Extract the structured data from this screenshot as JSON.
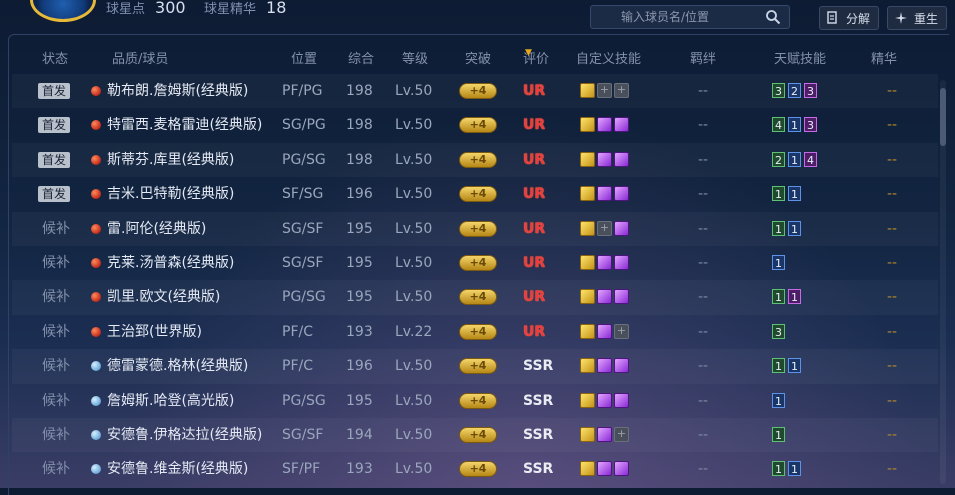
{
  "topbar": {
    "points_label": "球星点",
    "points_value": "300",
    "essence_label": "球星精华",
    "essence_value": "18",
    "search_placeholder": "输入球员名/位置",
    "decompose_label": "分解",
    "rebirth_label": "重生"
  },
  "table": {
    "headers": [
      "状态",
      "品质/球员",
      "位置",
      "综合",
      "等级",
      "突破",
      "评价",
      "自定义技能",
      "羁绊",
      "天赋技能",
      "精华"
    ],
    "sort_column": "评价",
    "rows": [
      {
        "status": "首发",
        "starter": true,
        "quality": "red",
        "name": "勒布朗.詹姆斯(经典版)",
        "position": "PF/PG",
        "overall": "198",
        "level": "Lv.50",
        "breakthrough": "+4",
        "rating": "UR",
        "skills": [
          "crown",
          "empty",
          "empty"
        ],
        "bond": "--",
        "talents": [
          {
            "v": "3",
            "c": "green"
          },
          {
            "v": "2",
            "c": "blue"
          },
          {
            "v": "3",
            "c": "purple"
          }
        ],
        "essence": "--"
      },
      {
        "status": "首发",
        "starter": true,
        "quality": "red",
        "name": "特雷西.麦格雷迪(经典版)",
        "position": "SG/PG",
        "overall": "198",
        "level": "Lv.50",
        "breakthrough": "+4",
        "rating": "UR",
        "skills": [
          "crown",
          "purple",
          "purple"
        ],
        "bond": "--",
        "talents": [
          {
            "v": "4",
            "c": "green"
          },
          {
            "v": "1",
            "c": "blue"
          },
          {
            "v": "3",
            "c": "purple"
          }
        ],
        "essence": "--"
      },
      {
        "status": "首发",
        "starter": true,
        "quality": "red",
        "name": "斯蒂芬.库里(经典版)",
        "position": "PG/SG",
        "overall": "198",
        "level": "Lv.50",
        "breakthrough": "+4",
        "rating": "UR",
        "skills": [
          "crown",
          "purple",
          "purple"
        ],
        "bond": "--",
        "talents": [
          {
            "v": "2",
            "c": "green"
          },
          {
            "v": "1",
            "c": "blue"
          },
          {
            "v": "4",
            "c": "purple"
          }
        ],
        "essence": "--"
      },
      {
        "status": "首发",
        "starter": true,
        "quality": "red",
        "name": "吉米.巴特勒(经典版)",
        "position": "SF/SG",
        "overall": "196",
        "level": "Lv.50",
        "breakthrough": "+4",
        "rating": "UR",
        "skills": [
          "crown",
          "purple",
          "purple"
        ],
        "bond": "--",
        "talents": [
          {
            "v": "1",
            "c": "green"
          },
          {
            "v": "1",
            "c": "blue"
          }
        ],
        "essence": "--"
      },
      {
        "status": "候补",
        "starter": false,
        "quality": "red",
        "name": "雷.阿伦(经典版)",
        "position": "SG/SF",
        "overall": "195",
        "level": "Lv.50",
        "breakthrough": "+4",
        "rating": "UR",
        "skills": [
          "crown",
          "empty",
          "purple"
        ],
        "bond": "--",
        "talents": [
          {
            "v": "1",
            "c": "green"
          },
          {
            "v": "1",
            "c": "blue"
          }
        ],
        "essence": "--"
      },
      {
        "status": "候补",
        "starter": false,
        "quality": "red",
        "name": "克莱.汤普森(经典版)",
        "position": "SG/SF",
        "overall": "195",
        "level": "Lv.50",
        "breakthrough": "+4",
        "rating": "UR",
        "skills": [
          "crown",
          "purple",
          "purple"
        ],
        "bond": "--",
        "talents": [
          {
            "v": "1",
            "c": "blue"
          }
        ],
        "essence": "--"
      },
      {
        "status": "候补",
        "starter": false,
        "quality": "red",
        "name": "凯里.欧文(经典版)",
        "position": "PG/SG",
        "overall": "195",
        "level": "Lv.50",
        "breakthrough": "+4",
        "rating": "UR",
        "skills": [
          "crown",
          "purple",
          "purple"
        ],
        "bond": "--",
        "talents": [
          {
            "v": "1",
            "c": "green"
          },
          {
            "v": "1",
            "c": "purple"
          }
        ],
        "essence": "--"
      },
      {
        "status": "候补",
        "starter": false,
        "quality": "red",
        "name": "王治郅(世界版)",
        "position": "PF/C",
        "overall": "193",
        "level": "Lv.22",
        "breakthrough": "+4",
        "rating": "UR",
        "skills": [
          "crown",
          "purple",
          "empty"
        ],
        "bond": "--",
        "talents": [
          {
            "v": "3",
            "c": "green"
          }
        ],
        "essence": "--"
      },
      {
        "status": "候补",
        "starter": false,
        "quality": "blue",
        "name": "德雷蒙德.格林(经典版)",
        "position": "PF/C",
        "overall": "196",
        "level": "Lv.50",
        "breakthrough": "+4",
        "rating": "SSR",
        "skills": [
          "crown",
          "purple",
          "purple"
        ],
        "bond": "--",
        "talents": [
          {
            "v": "1",
            "c": "green"
          },
          {
            "v": "1",
            "c": "blue"
          }
        ],
        "essence": "--"
      },
      {
        "status": "候补",
        "starter": false,
        "quality": "blue",
        "name": "詹姆斯.哈登(高光版)",
        "position": "PG/SG",
        "overall": "195",
        "level": "Lv.50",
        "breakthrough": "+4",
        "rating": "SSR",
        "skills": [
          "crown",
          "purple",
          "purple"
        ],
        "bond": "--",
        "talents": [
          {
            "v": "1",
            "c": "blue"
          }
        ],
        "essence": "--"
      },
      {
        "status": "候补",
        "starter": false,
        "quality": "blue",
        "name": "安德鲁.伊格达拉(经典版)",
        "position": "SG/SF",
        "overall": "194",
        "level": "Lv.50",
        "breakthrough": "+4",
        "rating": "SSR",
        "skills": [
          "crown",
          "purple",
          "empty"
        ],
        "bond": "--",
        "talents": [
          {
            "v": "1",
            "c": "green"
          }
        ],
        "essence": "--"
      },
      {
        "status": "候补",
        "starter": false,
        "quality": "blue",
        "name": "安德鲁.维金斯(经典版)",
        "position": "SF/PF",
        "overall": "193",
        "level": "Lv.50",
        "breakthrough": "+4",
        "rating": "SSR",
        "skills": [
          "crown",
          "purple",
          "purple"
        ],
        "bond": "--",
        "talents": [
          {
            "v": "1",
            "c": "green"
          },
          {
            "v": "1",
            "c": "blue"
          }
        ],
        "essence": "--"
      }
    ]
  },
  "colors": {
    "ur": "#ef3b3b",
    "accent_gold": "#e8a81d",
    "talent_green": "#5fbf75",
    "talent_blue": "#5d92e6",
    "talent_purple": "#c66ae8"
  },
  "icons": {
    "search": "search-icon",
    "decompose": "decompose-icon",
    "rebirth": "rebirth-icon",
    "skill_crown": "crown-skill-icon",
    "skill_purple": "purple-skill-icon",
    "skill_empty": "empty-skill-slot-icon"
  }
}
